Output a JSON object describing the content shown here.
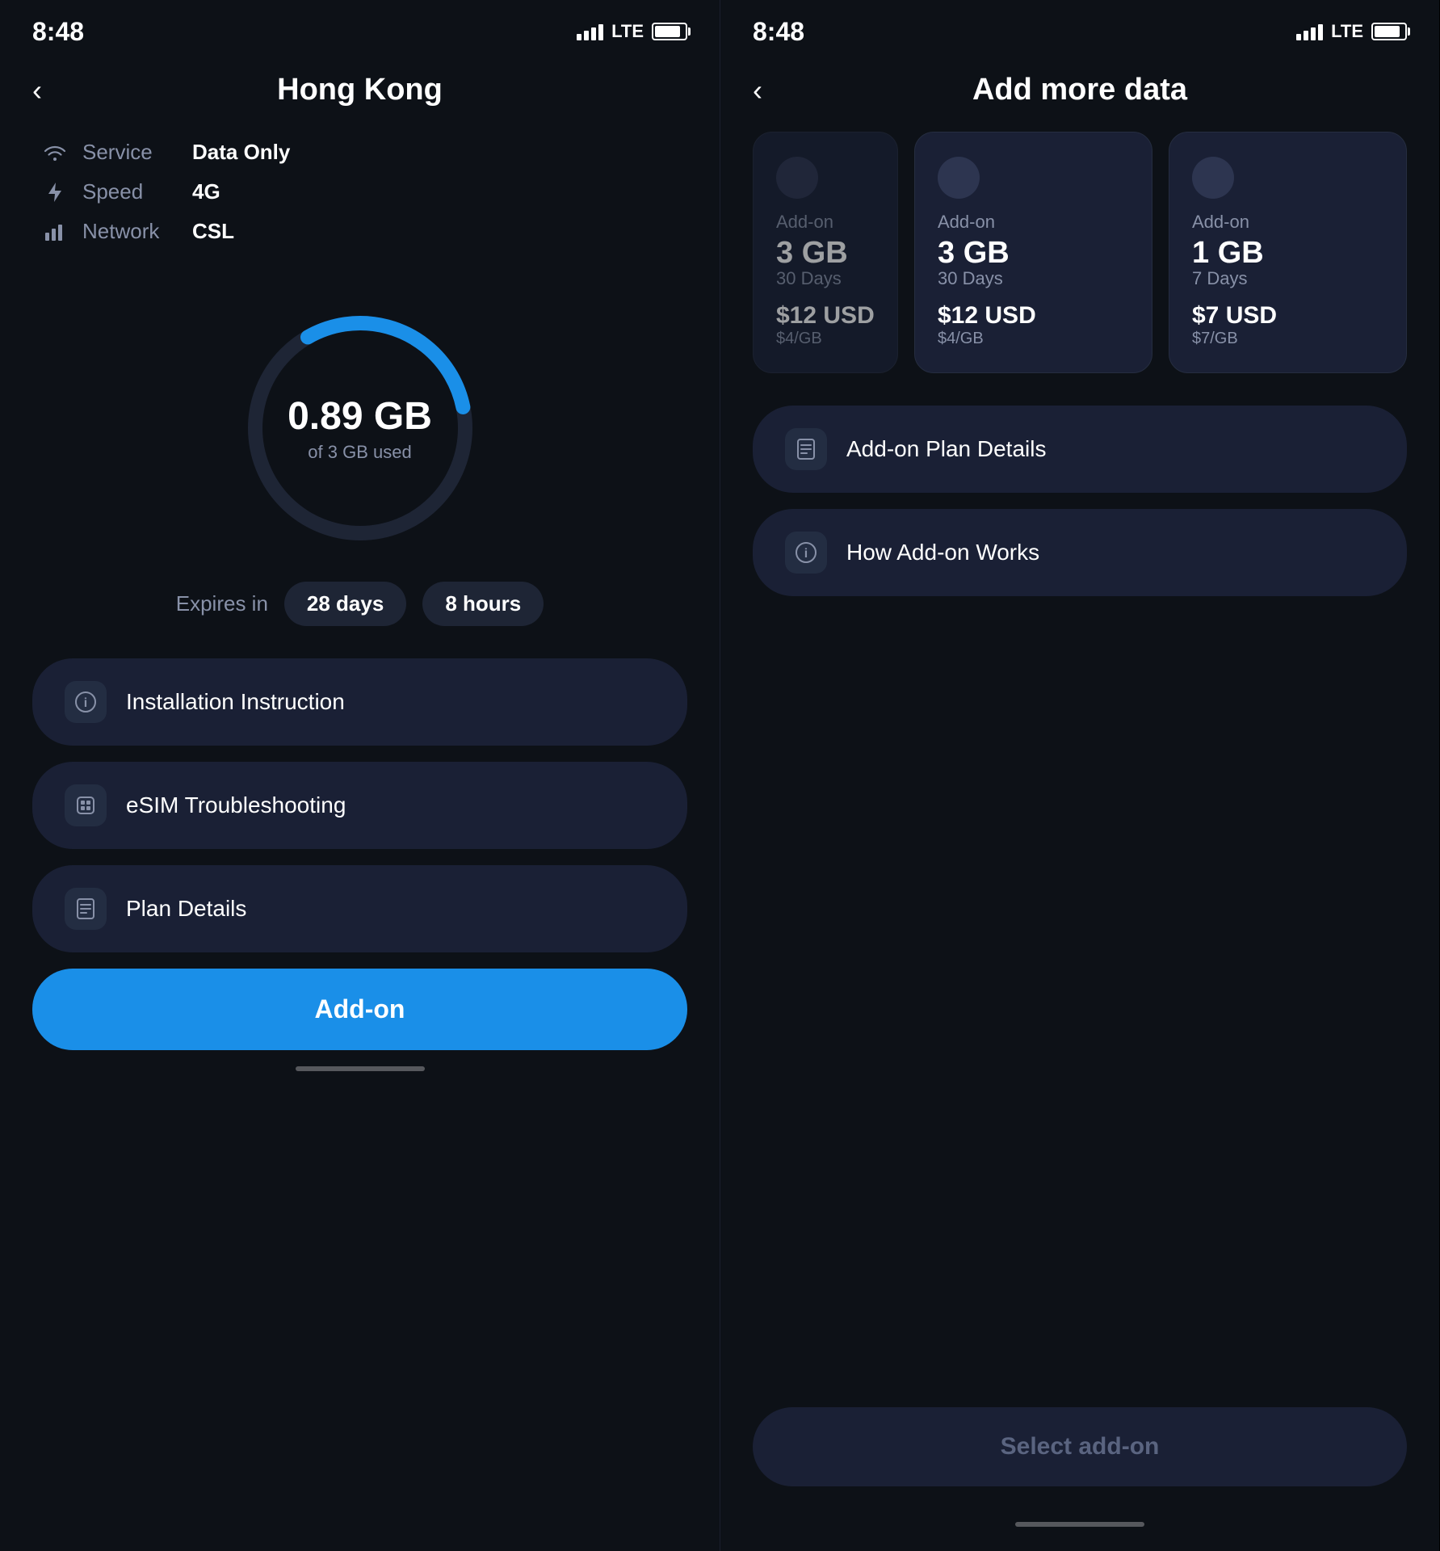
{
  "left": {
    "statusBar": {
      "time": "8:48",
      "lte": "LTE"
    },
    "header": {
      "backLabel": "‹",
      "title": "Hong Kong"
    },
    "info": {
      "service": {
        "label": "Service",
        "value": "Data Only"
      },
      "speed": {
        "label": "Speed",
        "value": "4G"
      },
      "network": {
        "label": "Network",
        "value": "CSL"
      }
    },
    "dataCircle": {
      "amount": "0.89 GB",
      "sub": "of 3 GB used",
      "progress": 30,
      "color": "#1a8fe8",
      "trackColor": "#1e2535"
    },
    "expires": {
      "label": "Expires in",
      "days": "28 days",
      "hours": "8 hours"
    },
    "menuItems": [
      {
        "id": "installation",
        "icon": "ℹ",
        "label": "Installation Instruction"
      },
      {
        "id": "troubleshoot",
        "icon": "⬡",
        "label": "eSIM Troubleshooting"
      },
      {
        "id": "plandetails",
        "icon": "📄",
        "label": "Plan Details"
      }
    ],
    "addonButton": "Add-on"
  },
  "right": {
    "statusBar": {
      "time": "8:48",
      "lte": "LTE"
    },
    "header": {
      "backLabel": "‹",
      "title": "Add more data"
    },
    "cards": [
      {
        "id": "card-partial",
        "type": "Add-on",
        "data": "3 GB",
        "days": "30 Days",
        "price": "$12 USD",
        "perGb": "$4/GB",
        "partial": true
      },
      {
        "id": "card-3gb",
        "type": "Add-on",
        "data": "3 GB",
        "days": "30 Days",
        "price": "$12 USD",
        "perGb": "$4/GB",
        "partial": false
      },
      {
        "id": "card-1gb",
        "type": "Add-on",
        "data": "1 GB",
        "days": "7 Days",
        "price": "$7 USD",
        "perGb": "$7/GB",
        "partial": false
      }
    ],
    "menuItems": [
      {
        "id": "addon-plan-details",
        "icon": "📄",
        "label": "Add-on Plan Details"
      },
      {
        "id": "how-addon-works",
        "icon": "ℹ",
        "label": "How Add-on Works"
      }
    ],
    "selectButton": "Select add-on"
  }
}
